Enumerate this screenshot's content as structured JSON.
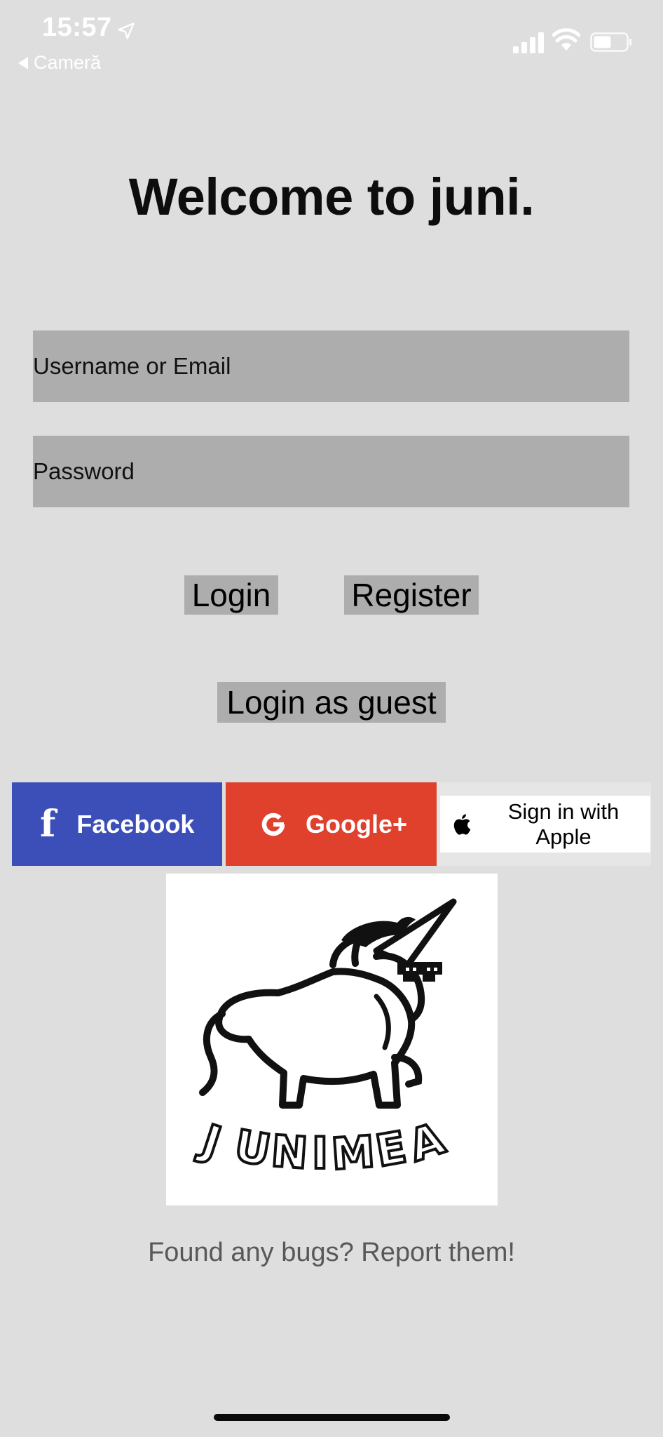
{
  "status_bar": {
    "time": "15:57",
    "back_label": "Cameră",
    "icons": [
      "location-arrow-icon",
      "signal-icon",
      "wifi-icon",
      "battery-icon"
    ]
  },
  "title": "Welcome to juni.",
  "login_form": {
    "username_placeholder": "Username or Email",
    "username_value": "",
    "password_placeholder": "Password",
    "password_value": ""
  },
  "buttons": {
    "login": "Login",
    "register": "Register",
    "guest": "Login as guest"
  },
  "social": {
    "facebook": "Facebook",
    "google": "Google+",
    "apple": "Sign in with Apple"
  },
  "logo": {
    "text": "JUNIMEA"
  },
  "footer": {
    "report_link": "Found any bugs? Report them!"
  },
  "colors": {
    "background": "#dedede",
    "input_background": "#adadad",
    "facebook": "#3c4fb8",
    "google": "#df412c",
    "apple": "#ffffff"
  }
}
